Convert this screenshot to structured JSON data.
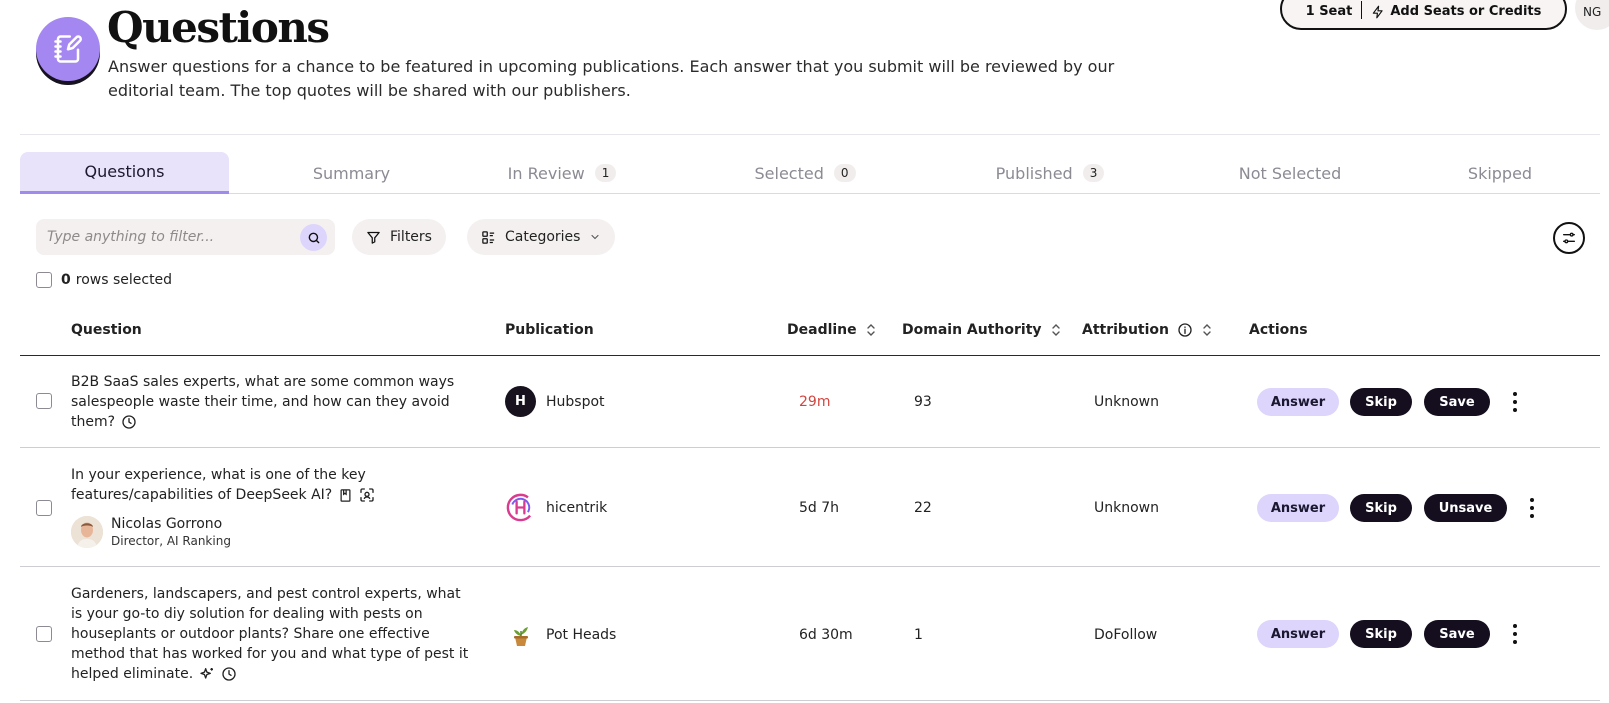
{
  "header": {
    "title": "Questions",
    "description": "Answer questions for a chance to be featured in upcoming publications. Each answer that you submit will be reviewed by our editorial team. The top quotes will be shared with our publishers.",
    "icon": "notebook-pen-icon"
  },
  "account": {
    "seat_label": "1 Seat",
    "add_label": "Add Seats or Credits",
    "initials": "NG"
  },
  "tabs": [
    {
      "label": "Questions",
      "count": null
    },
    {
      "label": "Summary",
      "count": null
    },
    {
      "label": "In Review",
      "count": "1"
    },
    {
      "label": "Selected",
      "count": "0"
    },
    {
      "label": "Published",
      "count": "3"
    },
    {
      "label": "Not Selected",
      "count": null
    },
    {
      "label": "Skipped",
      "count": null
    }
  ],
  "toolbar": {
    "search_placeholder": "Type anything to filter...",
    "filters_label": "Filters",
    "categories_label": "Categories"
  },
  "selection": {
    "count": "0",
    "label": "rows selected"
  },
  "table": {
    "headers": {
      "question": "Question",
      "publication": "Publication",
      "deadline": "Deadline",
      "domain_authority": "Domain Authority",
      "attribution": "Attribution",
      "actions": "Actions"
    },
    "rows": [
      {
        "question": "B2B SaaS sales experts, what are some common ways salespeople waste their time, and how can they avoid them?",
        "publication": "Hubspot",
        "publication_logo": "H",
        "deadline": "29m",
        "domain_authority": "93",
        "attribution": "Unknown",
        "answer_label": "Answer",
        "skip_label": "Skip",
        "save_label": "Save"
      },
      {
        "question": "In your experience, what is one of the key features/capabilities of DeepSeek AI?",
        "person_name": "Nicolas Gorrono",
        "person_role": "Director, AI Ranking",
        "publication": "hicentrik",
        "deadline": "5d 7h",
        "domain_authority": "22",
        "attribution": "Unknown",
        "answer_label": "Answer",
        "skip_label": "Skip",
        "save_label": "Unsave"
      },
      {
        "question": "Gardeners, landscapers, and pest control experts, what is your go-to diy solution for dealing with pests on houseplants or outdoor plants? Share one effective method that has worked for you and what type of pest it helped eliminate.",
        "publication": "Pot Heads",
        "deadline": "6d 30m",
        "domain_authority": "1",
        "attribution": "DoFollow",
        "answer_label": "Answer",
        "skip_label": "Skip",
        "save_label": "Save"
      }
    ]
  },
  "colors": {
    "accent": "#a487f0",
    "accent_light": "#ddd5fb",
    "dark_button": "#150e1e",
    "deadline_urgent": "#d2453f"
  }
}
